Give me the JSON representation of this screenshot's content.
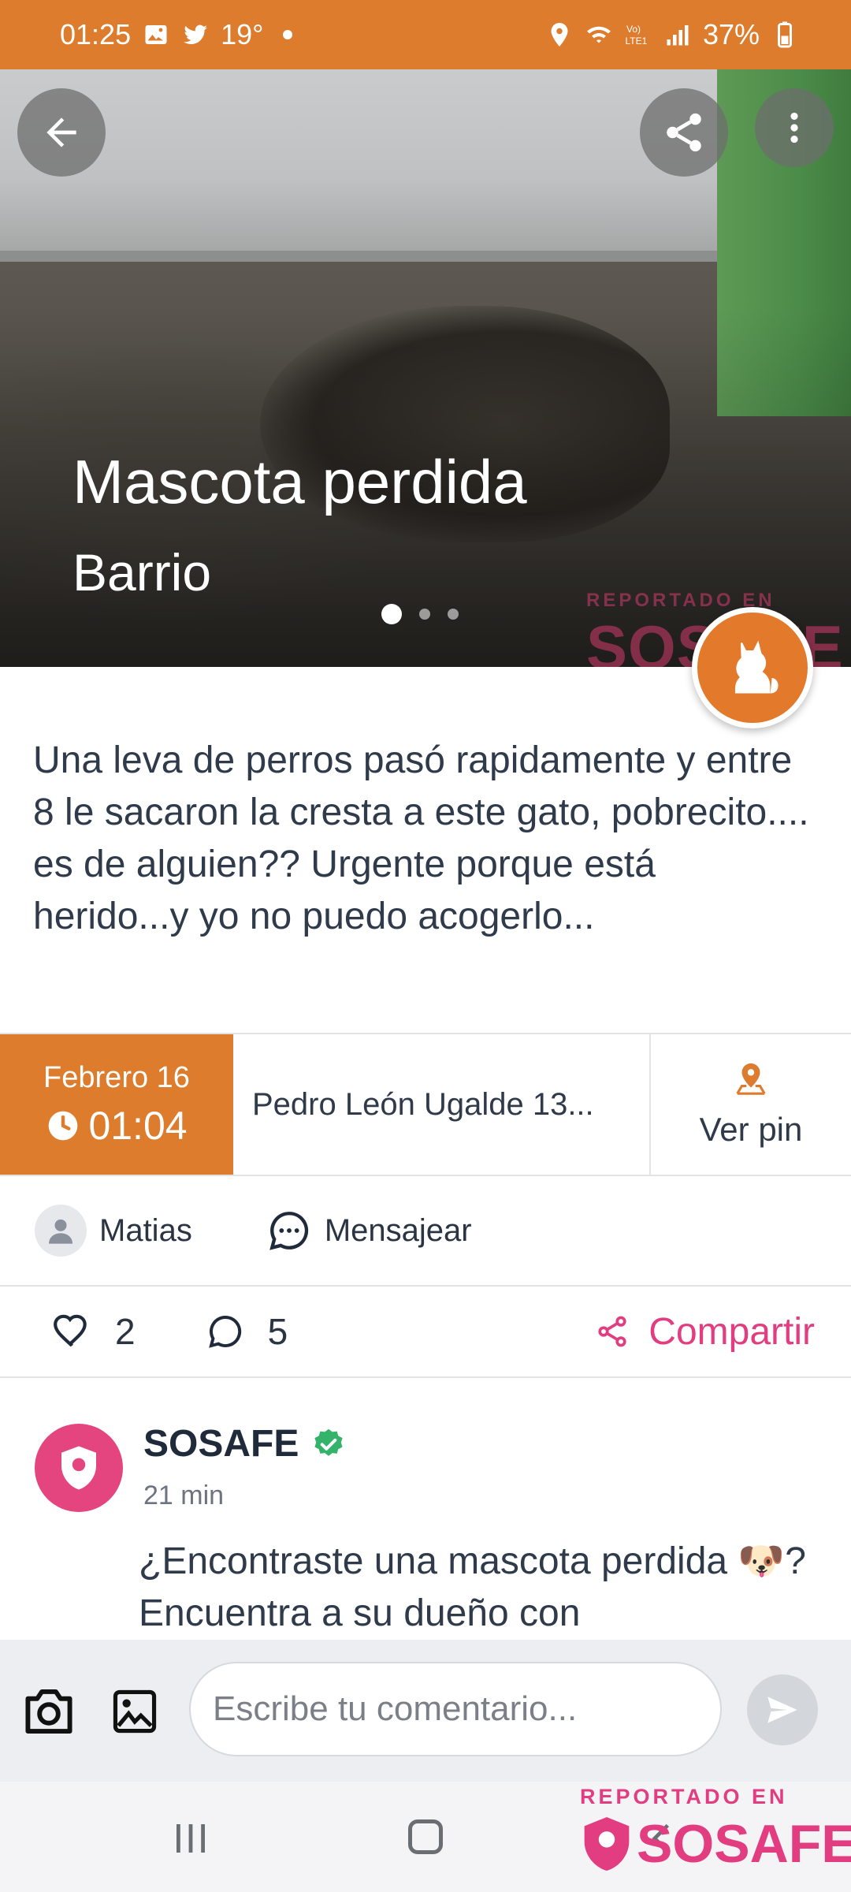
{
  "status_bar": {
    "time": "01:25",
    "temp": "19°",
    "battery": "37%"
  },
  "hero": {
    "title": "Mascota perdida",
    "subtitle": "Barrio",
    "watermark_small": "REPORTADO EN",
    "watermark_brand": "SOSAFE"
  },
  "description": "Una leva de perros pasó rapidamente y entre 8 le sacaron la cresta a este gato, pobrecito.... es de alguien?? Urgente porque está herido...y yo no puedo acogerlo...",
  "info": {
    "date": "Febrero 16",
    "time": "01:04",
    "address": "Pedro León Ugalde  13...",
    "pin_label": "Ver pin"
  },
  "user": {
    "name": "Matias",
    "message_label": "Mensajear"
  },
  "actions": {
    "likes": "2",
    "comments": "5",
    "share_label": "Compartir"
  },
  "comment": {
    "author": "SOSAFE",
    "time": "21 min",
    "text": "¿Encontraste una mascota perdida 🐶? Encuentra a su dueño con"
  },
  "composer": {
    "placeholder": "Escribe tu comentario..."
  },
  "watermark": {
    "small": "REPORTADO EN",
    "brand": "SOSAFE"
  },
  "colors": {
    "accent": "#dd7c2c",
    "brand": "#e23d80"
  }
}
